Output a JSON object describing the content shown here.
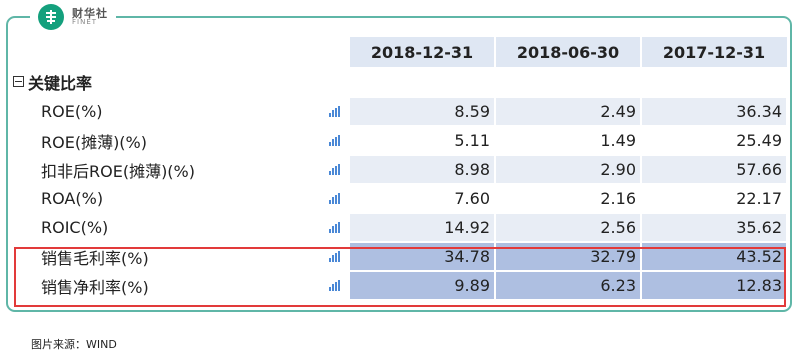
{
  "brand": {
    "name_cn": "财华社",
    "name_en": "FINET",
    "glyph": "华"
  },
  "table": {
    "columns": [
      "2018-12-31",
      "2018-06-30",
      "2017-12-31"
    ],
    "section": "关键比率",
    "rows": [
      {
        "name": "ROE(%)",
        "values": [
          "8.59",
          "2.49",
          "36.34"
        ]
      },
      {
        "name": "ROE(摊薄)(%)",
        "values": [
          "5.11",
          "1.49",
          "25.49"
        ]
      },
      {
        "name": "扣非后ROE(摊薄)(%)",
        "values": [
          "8.98",
          "2.90",
          "57.66"
        ]
      },
      {
        "name": "ROA(%)",
        "values": [
          "7.60",
          "2.16",
          "22.17"
        ]
      },
      {
        "name": "ROIC(%)",
        "values": [
          "14.92",
          "2.56",
          "35.62"
        ]
      },
      {
        "name": "销售毛利率(%)",
        "values": [
          "34.78",
          "32.79",
          "43.52"
        ]
      },
      {
        "name": "销售净利率(%)",
        "values": [
          "9.89",
          "6.23",
          "12.83"
        ]
      }
    ],
    "row_icon": "bar-chart-icon"
  },
  "source_text": "图片来源：WIND",
  "colors": {
    "frame": "#5fb6a7",
    "header_bg": "#dfe7f3",
    "shade": "#e8edf5",
    "highlight": "#aebfe1",
    "highlight_border": "#e23a3a",
    "icon": "#4a88d6",
    "logo": "#14a07d"
  }
}
